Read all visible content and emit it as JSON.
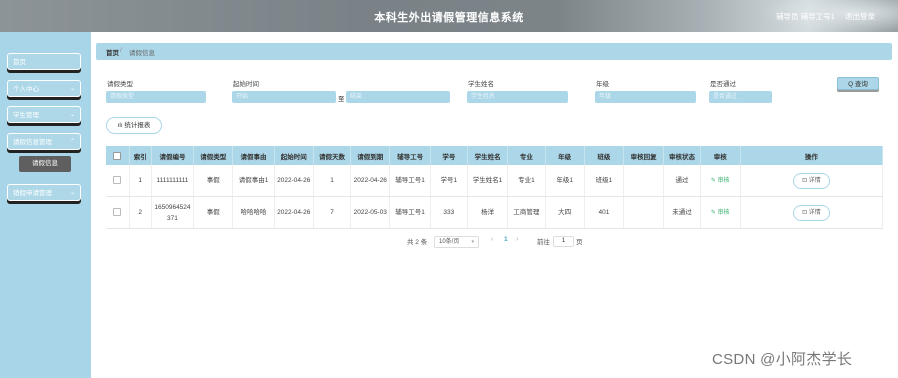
{
  "header": {
    "title": "本科生外出请假管理信息系统",
    "user": "辅导员 辅导工号1",
    "logout": "退出登录"
  },
  "sidebar": {
    "items": [
      {
        "label": "首页",
        "chevron": ""
      },
      {
        "label": "个人中心",
        "chevron": "⌄"
      },
      {
        "label": "学生管理",
        "chevron": "⌄"
      },
      {
        "label": "请假信息管理",
        "chevron": "⌃"
      },
      {
        "label": "销假申请管理",
        "chevron": "⌄"
      }
    ],
    "submenu": "请假信息"
  },
  "breadcrumb": {
    "home": "首页",
    "sep": "/",
    "current": "请假信息"
  },
  "filters": {
    "leave_type": {
      "label": "请假类型",
      "placeholder": "请假类型"
    },
    "start_time": {
      "label": "起始时间",
      "placeholder_from": "开始",
      "to": "至",
      "placeholder_to": "结束"
    },
    "student_name": {
      "label": "学生姓名",
      "placeholder": "学生姓名"
    },
    "grade": {
      "label": "年级",
      "placeholder": "年级"
    },
    "approved": {
      "label": "是否通过",
      "placeholder": "是否通过"
    },
    "search_button": "Q 查询"
  },
  "stat_button": "ılı 统计报表",
  "table": {
    "columns": [
      "",
      "索引",
      "请假编号",
      "请假类型",
      "请假事由",
      "起始时间",
      "请假天数",
      "请假到期",
      "辅导工号",
      "学号",
      "学生姓名",
      "专业",
      "年级",
      "班级",
      "审核回复",
      "审核状态",
      "审核",
      "操作"
    ],
    "rows": [
      {
        "index": "1",
        "leave_no": "1111111111",
        "type": "事假",
        "reason": "请假事由1",
        "start": "2022-04-26",
        "days": "1",
        "end": "2022-04-26",
        "tutor": "辅导工号1",
        "student_no": "学号1",
        "name": "学生姓名1",
        "major": "专业1",
        "grade": "年级1",
        "class": "班级1",
        "reply": "",
        "status": "通过",
        "audit": "✎ 审核",
        "detail": "⊡ 详情"
      },
      {
        "index": "2",
        "leave_no": "1650964524371",
        "type": "事假",
        "reason": "哈哈哈哈",
        "start": "2022-04-26",
        "days": "7",
        "end": "2022-05-03",
        "tutor": "辅导工号1",
        "student_no": "333",
        "name": "杨洋",
        "major": "工商管理",
        "grade": "大四",
        "class": "401",
        "reply": "",
        "status": "未通过",
        "audit": "✎ 审核",
        "detail": "⊡ 详情"
      }
    ]
  },
  "pagination": {
    "total": "共 2 条",
    "page_size": "10条/页",
    "prev": "‹",
    "current_page": "1",
    "next": "›",
    "goto_label": "前往",
    "goto_value": "1",
    "page_suffix": "页"
  },
  "watermark": "CSDN @小阿杰学长"
}
